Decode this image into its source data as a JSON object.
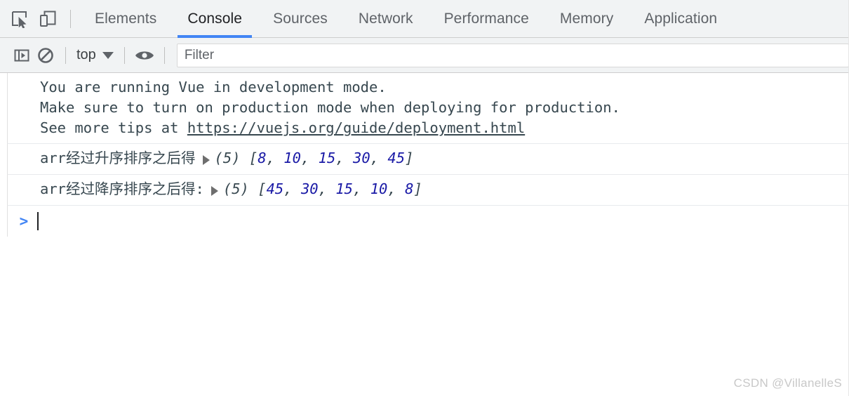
{
  "tabbar": {
    "inspect_icon": "inspect-cursor-icon",
    "device_icon": "device-toolbar-icon",
    "tabs": [
      {
        "label": "Elements",
        "active": false
      },
      {
        "label": "Console",
        "active": true
      },
      {
        "label": "Sources",
        "active": false
      },
      {
        "label": "Network",
        "active": false
      },
      {
        "label": "Performance",
        "active": false
      },
      {
        "label": "Memory",
        "active": false
      },
      {
        "label": "Application",
        "active": false
      }
    ],
    "active_tab": "Console",
    "accent_color": "#4285f4"
  },
  "toolbar": {
    "sidebar_icon": "show-console-sidebar-icon",
    "clear_icon": "clear-console-icon",
    "context_label": "top",
    "context_caret": "chevron-down-icon",
    "eye_icon": "live-expression-eye-icon",
    "filter_placeholder": "Filter",
    "filter_value": ""
  },
  "console": {
    "messages": [
      {
        "type": "info",
        "lines": [
          "You are running Vue in development mode.",
          "Make sure to turn on production mode when deploying for production.",
          "See more tips at "
        ],
        "link": "https://vuejs.org/guide/deployment.html"
      },
      {
        "type": "log",
        "label": "arr经过升序排序之后得",
        "array": {
          "length_label": "(5)",
          "values": [
            8,
            10,
            15,
            30,
            45
          ]
        }
      },
      {
        "type": "log",
        "label": "arr经过降序排序之后得:",
        "array": {
          "length_label": "(5)",
          "values": [
            45,
            30,
            15,
            10,
            8
          ]
        }
      }
    ],
    "prompt_symbol": ">",
    "prompt_value": ""
  },
  "watermark": {
    "text": "CSDN @VillanelleS"
  },
  "colors": {
    "number_literal": "#1a1aa6",
    "toolbar_bg": "#f1f3f4",
    "text": "#37474f"
  }
}
